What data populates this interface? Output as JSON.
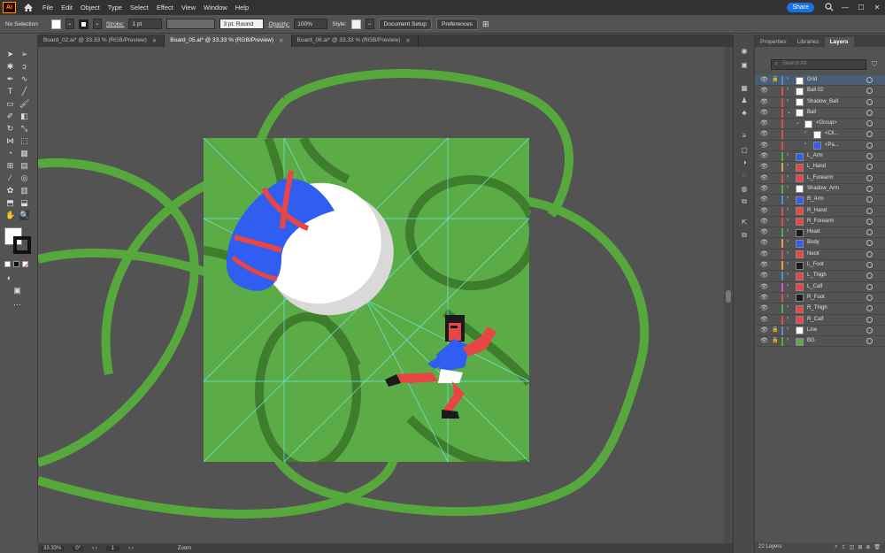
{
  "app": {
    "logo": "Ai",
    "home_icon": "home-icon"
  },
  "menu": [
    "File",
    "Edit",
    "Object",
    "Type",
    "Select",
    "Effect",
    "View",
    "Window",
    "Help"
  ],
  "topright": {
    "share": "Share",
    "search_icon": "search-icon",
    "min": "—",
    "max": "☐",
    "close": "✕"
  },
  "control": {
    "selection": "No Selection",
    "stroke_label": "Stroke:",
    "stroke_value": "1 pt",
    "brush": "3 pt. Round",
    "opacity_label": "Opacity:",
    "opacity_value": "100%",
    "style_label": "Style:",
    "doc_setup": "Document Setup",
    "preferences": "Preferences"
  },
  "tabs": [
    {
      "label": "Board_02.ai* @ 33.33 % (RGB/Preview)",
      "active": false
    },
    {
      "label": "Board_05.ai* @ 33.33 % (RGB/Preview)",
      "active": true
    },
    {
      "label": "Board_06.ai* @ 33.33 % (RGB/Preview)",
      "active": false
    }
  ],
  "status": {
    "zoom": "33.33%",
    "rotation": "0°",
    "artboard": "1",
    "mode": "Zoom"
  },
  "panel": {
    "tabs": [
      "Properties",
      "Libraries",
      "Layers"
    ],
    "active_tab": "Layers",
    "search_placeholder": "Search All",
    "footer": "22 Layers"
  },
  "layers": [
    {
      "name": "Grid",
      "color": "#4f8fd9",
      "indent": 0,
      "expanded": false,
      "locked": true,
      "selected": true,
      "thumb": "#ffffff"
    },
    {
      "name": "Ball 02",
      "color": "#d94f4f",
      "indent": 0,
      "expanded": false,
      "locked": false,
      "selected": false,
      "thumb": "#ffffff"
    },
    {
      "name": "Shadow_Ball",
      "color": "#d94f4f",
      "indent": 0,
      "expanded": false,
      "locked": false,
      "selected": false,
      "thumb": "#ffffff"
    },
    {
      "name": "Ball",
      "color": "#d94f4f",
      "indent": 0,
      "expanded": true,
      "locked": false,
      "selected": false,
      "thumb": "#ffffff"
    },
    {
      "name": "<Group>",
      "color": "#d94f4f",
      "indent": 1,
      "expanded": true,
      "locked": false,
      "selected": false,
      "thumb": "#ffffff"
    },
    {
      "name": "<Cli...",
      "color": "#d94f4f",
      "indent": 2,
      "expanded": false,
      "locked": false,
      "selected": false,
      "thumb": "#ffffff"
    },
    {
      "name": "<Pa...",
      "color": "#d94f4f",
      "indent": 2,
      "expanded": false,
      "locked": false,
      "selected": false,
      "thumb": "#2f5ef0"
    },
    {
      "name": "L_Arm",
      "color": "#4fb04f",
      "indent": 0,
      "expanded": false,
      "locked": false,
      "selected": false,
      "thumb": "#2f5ef0"
    },
    {
      "name": "L_Hand",
      "color": "#d9a34f",
      "indent": 0,
      "expanded": false,
      "locked": false,
      "selected": false,
      "thumb": "#e84545"
    },
    {
      "name": "L_Forearm",
      "color": "#d94f4f",
      "indent": 0,
      "expanded": false,
      "locked": false,
      "selected": false,
      "thumb": "#e84545"
    },
    {
      "name": "Shadow_Arm",
      "color": "#4fb04f",
      "indent": 0,
      "expanded": false,
      "locked": false,
      "selected": false,
      "thumb": "#ffffff"
    },
    {
      "name": "R_Arm",
      "color": "#4f8fd9",
      "indent": 0,
      "expanded": false,
      "locked": false,
      "selected": false,
      "thumb": "#2f5ef0"
    },
    {
      "name": "R_Hand",
      "color": "#d94f4f",
      "indent": 0,
      "expanded": false,
      "locked": false,
      "selected": false,
      "thumb": "#e84545"
    },
    {
      "name": "R_Forearm",
      "color": "#d94f4f",
      "indent": 0,
      "expanded": false,
      "locked": false,
      "selected": false,
      "thumb": "#e84545"
    },
    {
      "name": "Head",
      "color": "#4fb04f",
      "indent": 0,
      "expanded": false,
      "locked": false,
      "selected": false,
      "thumb": "#1a1a1a"
    },
    {
      "name": "Body",
      "color": "#d9a34f",
      "indent": 0,
      "expanded": false,
      "locked": false,
      "selected": false,
      "thumb": "#2f5ef0"
    },
    {
      "name": "Neck",
      "color": "#d94f4f",
      "indent": 0,
      "expanded": false,
      "locked": false,
      "selected": false,
      "thumb": "#e84545"
    },
    {
      "name": "L_Foot",
      "color": "#d9a34f",
      "indent": 0,
      "expanded": false,
      "locked": false,
      "selected": false,
      "thumb": "#1a1a1a"
    },
    {
      "name": "L_Thigh",
      "color": "#4f8fd9",
      "indent": 0,
      "expanded": false,
      "locked": false,
      "selected": false,
      "thumb": "#e84545"
    },
    {
      "name": "L_Calf",
      "color": "#d94fd9",
      "indent": 0,
      "expanded": false,
      "locked": false,
      "selected": false,
      "thumb": "#e84545"
    },
    {
      "name": "R_Foot",
      "color": "#d94f4f",
      "indent": 0,
      "expanded": false,
      "locked": false,
      "selected": false,
      "thumb": "#1a1a1a"
    },
    {
      "name": "R_Thigh",
      "color": "#4fb04f",
      "indent": 0,
      "expanded": false,
      "locked": false,
      "selected": false,
      "thumb": "#e84545"
    },
    {
      "name": "R_Calf",
      "color": "#d94f4f",
      "indent": 0,
      "expanded": false,
      "locked": false,
      "selected": false,
      "thumb": "#e84545"
    },
    {
      "name": "Line",
      "color": "#4f8fd9",
      "indent": 0,
      "expanded": false,
      "locked": true,
      "selected": false,
      "thumb": "#ffffff"
    },
    {
      "name": "BG",
      "color": "#4fb04f",
      "indent": 0,
      "expanded": false,
      "locked": true,
      "selected": false,
      "thumb": "#5bac46"
    }
  ],
  "colors": {
    "artboard_green": "#5bac46",
    "ring_green": "#56a83d",
    "dark_green": "#3e7d2c",
    "guide_cyan": "#6ee8e8",
    "ball_blue": "#2f5ef0",
    "ball_red": "#e84545",
    "accent_blue": "#1473e6"
  }
}
